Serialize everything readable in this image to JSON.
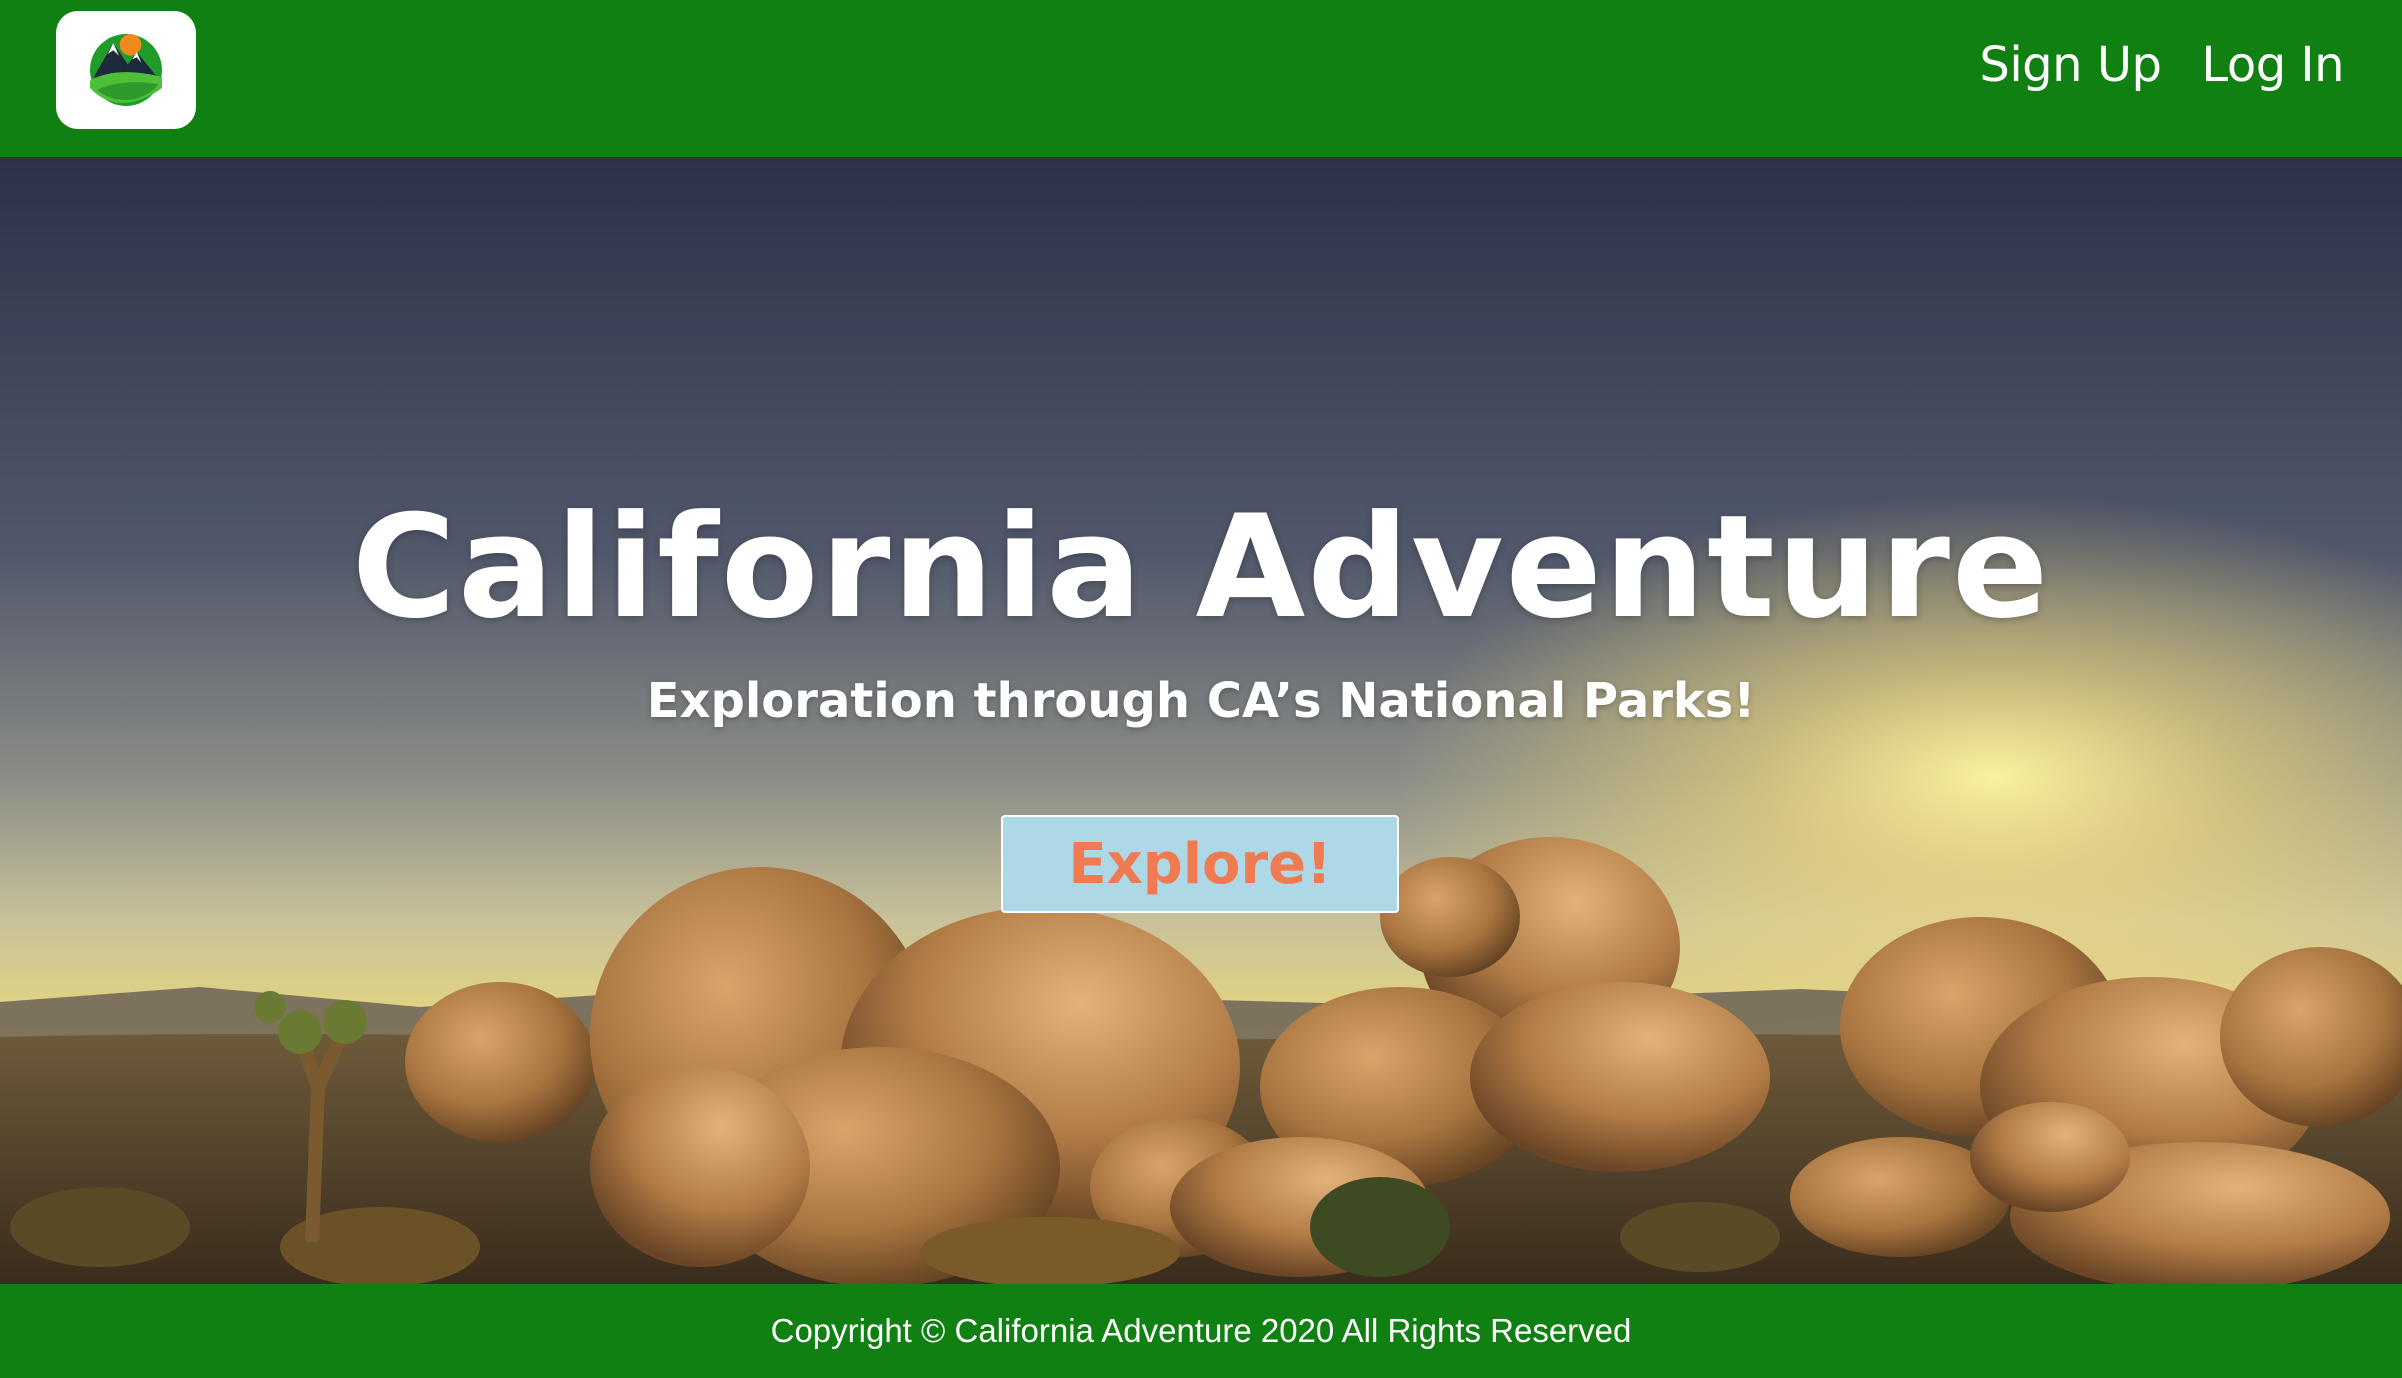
{
  "header": {
    "logo_icon": "mountain-landscape-logo",
    "nav": {
      "sign_up": "Sign Up",
      "log_in": "Log In"
    }
  },
  "hero": {
    "title": "California Adventure",
    "subtitle": "Exploration through CA’s National Parks!",
    "explore_label": "Explore!"
  },
  "footer": {
    "copyright": "Copyright © California Adventure 2020 All Rights Reserved"
  },
  "colors": {
    "brand_green": "#108012",
    "button_bg": "#add8e6",
    "button_text": "#f07b52",
    "text_white": "#ffffff"
  }
}
